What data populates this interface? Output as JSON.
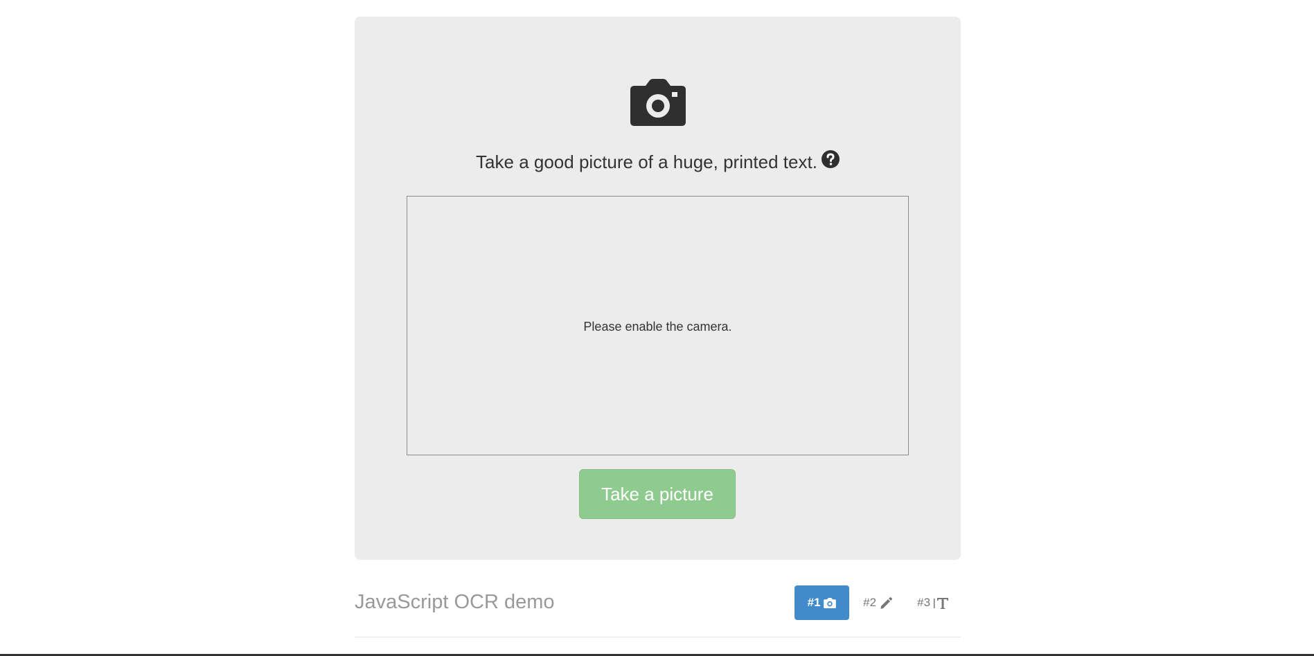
{
  "hero": {
    "icon": "camera-icon",
    "instruction": "Take a good picture of a huge, printed text.",
    "help_icon": "question-circle-icon"
  },
  "video": {
    "message": "Please enable the camera."
  },
  "actions": {
    "take_picture_label": "Take a picture",
    "take_picture_color": "#8fcb8f"
  },
  "footer": {
    "brand": "JavaScript OCR demo",
    "steps": [
      {
        "label": "#1",
        "icon": "camera-icon",
        "active": true
      },
      {
        "label": "#2",
        "icon": "pencil-icon",
        "active": false
      },
      {
        "label": "#3",
        "icon": "text-icon",
        "active": false
      }
    ],
    "active_color": "#428bca"
  }
}
